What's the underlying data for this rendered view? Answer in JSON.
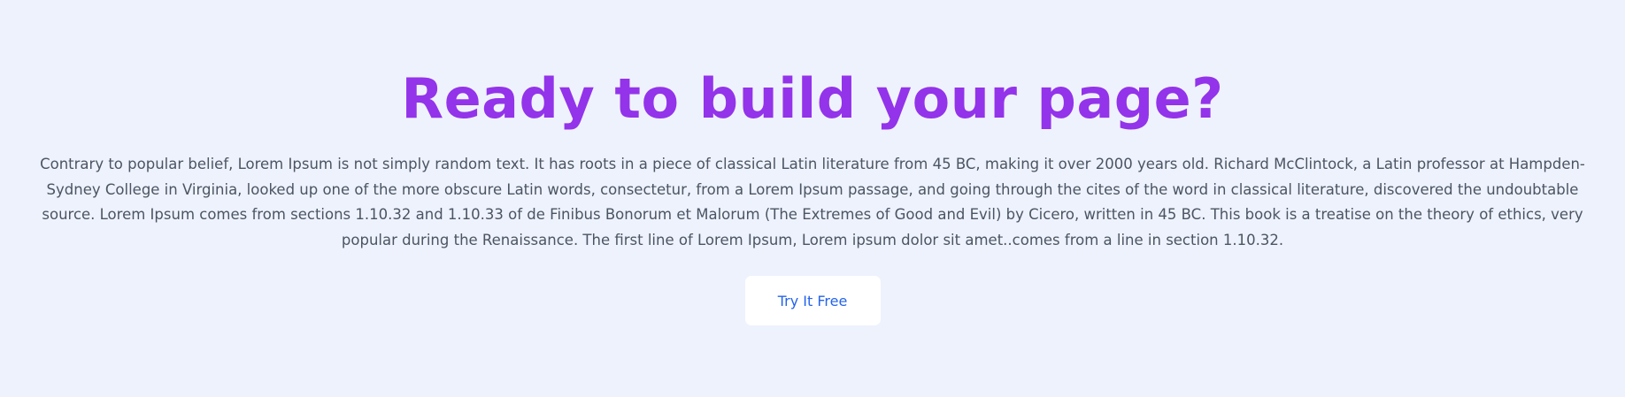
{
  "cta": {
    "title": "Ready to build your page?",
    "description": "Contrary to popular belief, Lorem Ipsum is not simply random text. It has roots in a piece of classical Latin literature from 45 BC, making it over 2000 years old. Richard McClintock, a Latin professor at Hampden-Sydney College in Virginia, looked up one of the more obscure Latin words, consectetur, from a Lorem Ipsum passage, and going through the cites of the word in classical literature, discovered the undoubtable source. Lorem Ipsum comes from sections 1.10.32 and 1.10.33 of de Finibus Bonorum et Malorum (The Extremes of Good and Evil) by Cicero, written in 45 BC. This book is a treatise on the theory of ethics, very popular during the Renaissance. The first line of Lorem Ipsum, Lorem ipsum dolor sit amet..comes from a line in section 1.10.32.",
    "button_label": "Try It Free"
  },
  "colors": {
    "background": "#eef2fd",
    "title": "#9333ea",
    "text": "#4b5563",
    "button_text": "#2563eb",
    "button_background": "#ffffff"
  }
}
